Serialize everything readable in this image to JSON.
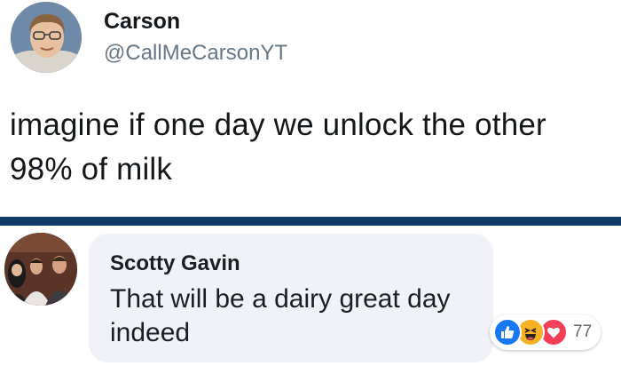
{
  "tweet": {
    "name": "Carson",
    "handle": "@CallMeCarsonYT",
    "text": "imagine if one day we unlock the other 98% of milk",
    "avatar_icon": "profile-photo"
  },
  "divider_color": "#123a66",
  "comment": {
    "author": "Scotty Gavin",
    "text": "That will be a dairy great day indeed",
    "avatar_icon": "group-profile-photo",
    "reactions": {
      "icons": [
        "like-icon",
        "haha-icon",
        "love-icon"
      ],
      "count": "77",
      "colors": {
        "like": "#1877f2",
        "haha": "#f7b125",
        "love": "#f33e58"
      }
    }
  }
}
